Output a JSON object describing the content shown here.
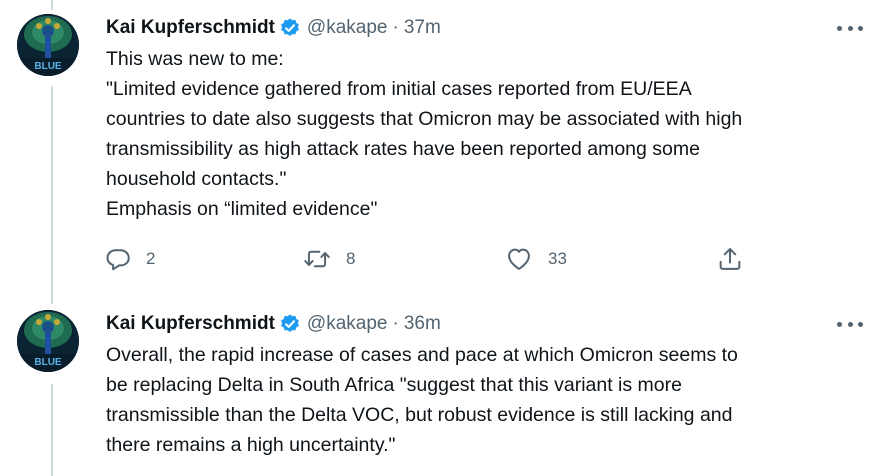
{
  "tweets": [
    {
      "author_name": "Kai Kupferschmidt",
      "handle": "@kakape",
      "separator": "·",
      "time": "37m",
      "avatar_text": "BLUE",
      "lines": [
        "This was new to me:",
        "\"Limited evidence gathered from initial cases reported from EU/EEA",
        "countries to date also suggests that Omicron may be associated with high",
        "transmissibility as high attack rates have been reported among some",
        "household contacts.\"",
        "Emphasis on “limited evidence\""
      ],
      "replies": "2",
      "retweets": "8",
      "likes": "33"
    },
    {
      "author_name": "Kai Kupferschmidt",
      "handle": "@kakape",
      "separator": "·",
      "time": "36m",
      "avatar_text": "BLUE",
      "lines": [
        "Overall, the rapid increase of cases and pace at which Omicron seems to",
        "be replacing Delta in South Africa \"suggest that this variant is more",
        "transmissible than the Delta VOC, but robust evidence is still lacking and",
        "there remains a high uncertainty.\""
      ]
    }
  ],
  "colors": {
    "verified": "#1d9bf0",
    "secondary_text": "#536471",
    "thread_line": "#cfd9de"
  },
  "icons": [
    "verified-badge-icon",
    "more-options-icon",
    "reply-icon",
    "retweet-icon",
    "like-icon",
    "share-icon"
  ]
}
